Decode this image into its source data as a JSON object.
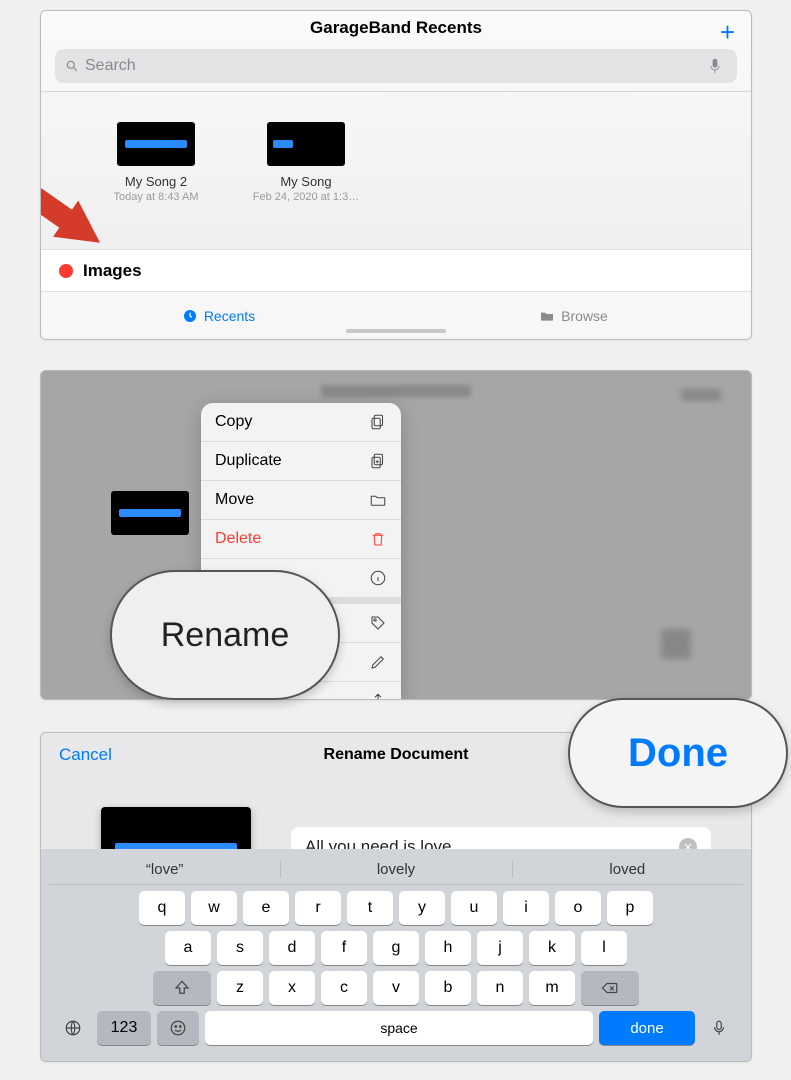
{
  "panel1": {
    "title": "GarageBand Recents",
    "search_placeholder": "Search",
    "files": [
      {
        "name": "My Song 2",
        "date": "Today at 8:43 AM"
      },
      {
        "name": "My Song",
        "date": "Feb 24, 2020 at 1:3…"
      }
    ],
    "section": "Images",
    "tabs": {
      "recents": "Recents",
      "browse": "Browse"
    }
  },
  "panel2": {
    "menu": {
      "copy": "Copy",
      "duplicate": "Duplicate",
      "move": "Move",
      "delete": "Delete",
      "info": "Info"
    },
    "highlight": "Rename"
  },
  "panel3": {
    "cancel": "Cancel",
    "title": "Rename Document",
    "input_value": "All you need is love",
    "highlight": "Done",
    "suggestions": [
      "“love”",
      "lovely",
      "loved"
    ],
    "keys": {
      "row1": [
        "q",
        "w",
        "e",
        "r",
        "t",
        "y",
        "u",
        "i",
        "o",
        "p"
      ],
      "row2": [
        "a",
        "s",
        "d",
        "f",
        "g",
        "h",
        "j",
        "k",
        "l"
      ],
      "row3": [
        "z",
        "x",
        "c",
        "v",
        "b",
        "n",
        "m"
      ],
      "num": "123",
      "space": "space",
      "done": "done"
    }
  }
}
